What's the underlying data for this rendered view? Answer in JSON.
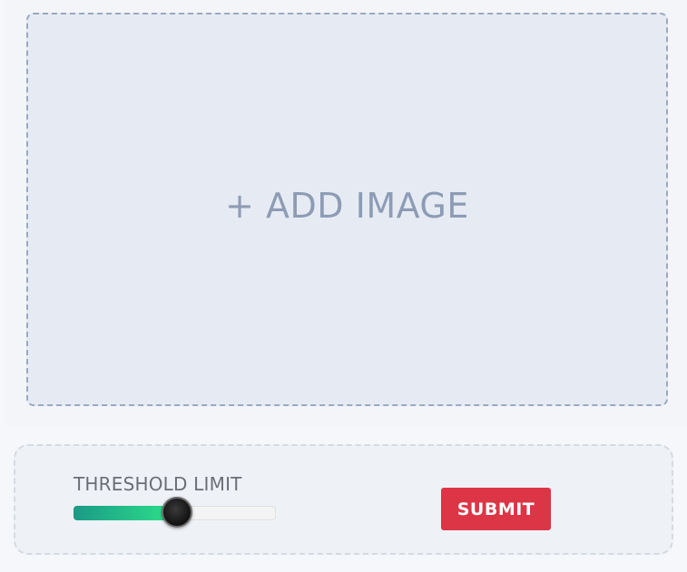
{
  "upload": {
    "label": "+ ADD IMAGE"
  },
  "threshold": {
    "label": "THRESHOLD LIMIT",
    "value": 0.51
  },
  "submit": {
    "label": "SUBMIT"
  },
  "colors": {
    "accent": "#dc3545",
    "slider_fill_start": "#1a9a86",
    "slider_fill_end": "#2ee28a"
  }
}
